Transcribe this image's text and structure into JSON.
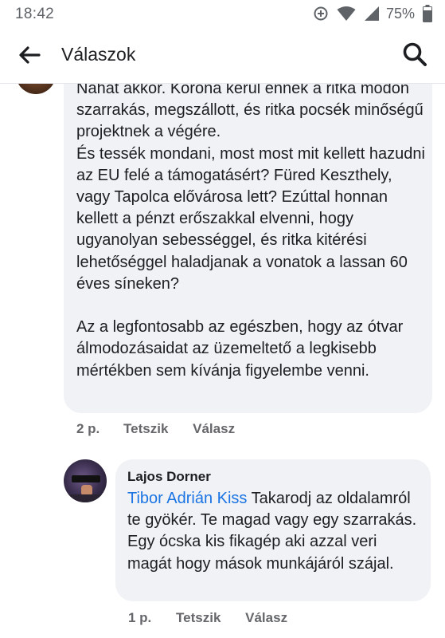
{
  "status_bar": {
    "time": "18:42",
    "battery": "75%",
    "icons": [
      "data-saver-icon",
      "wifi-icon",
      "signal-icon",
      "battery-icon"
    ]
  },
  "header": {
    "title": "Válaszok",
    "back_icon": "arrow-left-icon",
    "search_icon": "search-icon"
  },
  "comments": [
    {
      "text": "Nahát akkor. Korona kerül ennek a ritka módon szarrakás, megszállott, és ritka pocsék minőségű projektnek a végére.\nÉs tessék mondani, most most mit kellett hazudni az EU felé a támogatásért? Füred Keszthely, vagy Tapolca elővárosa lett? Ezúttal honnan kellett a pénzt erőszakkal elvenni, hogy ugyanolyan sebességgel, és ritka kitérési lehetőséggel haladjanak a vonatok a lassan 60 éves síneken?\n\nAz a legfontosabb az egészben, hogy az ótvar álmodozásaidat az üzemeltető a legkisebb mértékben sem kívánja figyelembe venni.",
      "time": "2 p.",
      "like_label": "Tetszik",
      "reply_label": "Válasz"
    },
    {
      "author": "Lajos Dorner",
      "mention": "Tibor Adrián Kiss",
      "text": " Takarodj az oldalamról te gyökér. Te magad vagy egy szarrakás. Egy ócska kis fikagép aki azzal veri magát hogy mások munkájáról szájal.",
      "time": "1 p.",
      "like_label": "Tetszik",
      "reply_label": "Válasz"
    }
  ],
  "colors": {
    "bubble": "#f0f2f5",
    "mention": "#1b74e4",
    "meta": "#65676b",
    "text": "#1c1e21"
  }
}
